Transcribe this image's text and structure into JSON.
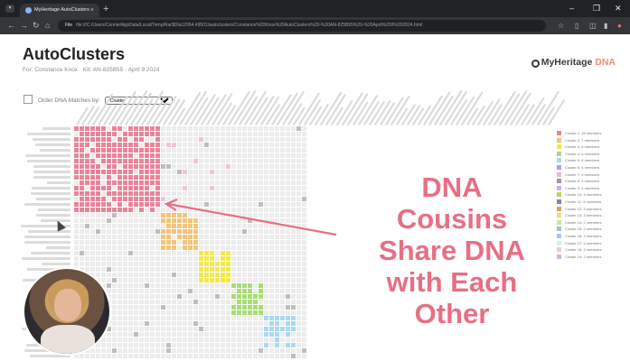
{
  "browser": {
    "tab_title": "MyHeritage AutoClusters",
    "tab_close": "×",
    "new_tab": "+",
    "url_prefix": "File",
    "url": "file:///C:/Users/Connie/AppData/Local/Temp/Rar$DIa12064.49501/autoclusters/Constance%20Knox%20AutoClusters%20-%20AN-825B55%20-%20April%209%202024.html",
    "window_controls": [
      "–",
      "❐",
      "✕"
    ]
  },
  "page": {
    "title": "AutoClusters",
    "subtitle": "For: Constance Knox · Kit: AN-825B55 · April 9 2024",
    "logo_text": "MyHeritage",
    "logo_dna": "DNA",
    "order_label": "Order DNA Matches by:",
    "order_value": "Cluster"
  },
  "overlay": {
    "lines": [
      "DNA",
      "Cousins",
      "Share DNA",
      "with Each",
      "Other"
    ],
    "color": "#e76f84"
  },
  "legend": [
    {
      "label": "Cluster 1: 16 members",
      "color": "#e8849a"
    },
    {
      "label": "Cluster 2: 7 members",
      "color": "#f2c37a"
    },
    {
      "label": "Cluster 3: 6 members",
      "color": "#f2e84e"
    },
    {
      "label": "Cluster 4: 6 members",
      "color": "#a7dd72"
    },
    {
      "label": "Cluster 5: 6 members",
      "color": "#a8d9f0"
    },
    {
      "label": "Cluster 6: 4 members",
      "color": "#9fa8e8"
    },
    {
      "label": "Cluster 7: 4 members",
      "color": "#f6b6cf"
    },
    {
      "label": "Cluster 8: 4 members",
      "color": "#9a9a9a"
    },
    {
      "label": "Cluster 9: 4 members",
      "color": "#c7b3e6"
    },
    {
      "label": "Cluster 10: 4 members",
      "color": "#b8d65a"
    },
    {
      "label": "Cluster 11: 3 members",
      "color": "#8d7fb8"
    },
    {
      "label": "Cluster 12: 3 members",
      "color": "#e6a05a"
    },
    {
      "label": "Cluster 13: 3 members",
      "color": "#efe06c"
    },
    {
      "label": "Cluster 14: 2 members",
      "color": "#c9e9a0"
    },
    {
      "label": "Cluster 15: 2 members",
      "color": "#9ec4d8"
    },
    {
      "label": "Cluster 16: 2 members",
      "color": "#b6c0ea"
    },
    {
      "label": "Cluster 17: 2 members",
      "color": "#d9ecf6"
    },
    {
      "label": "Cluster 18: 2 members",
      "color": "#f4c6d6"
    },
    {
      "label": "Cluster 19: 2 members",
      "color": "#d8b3e0"
    }
  ],
  "matrix": {
    "clusters": [
      {
        "size": 16,
        "color": "#e8849a"
      },
      {
        "size": 7,
        "color": "#f2c37a"
      },
      {
        "size": 6,
        "color": "#f2e84e"
      },
      {
        "size": 6,
        "color": "#a7dd72"
      },
      {
        "size": 6,
        "color": "#a8d9f0"
      }
    ],
    "empty_color": "#ececec",
    "gray_color": "#bdbdbd"
  }
}
